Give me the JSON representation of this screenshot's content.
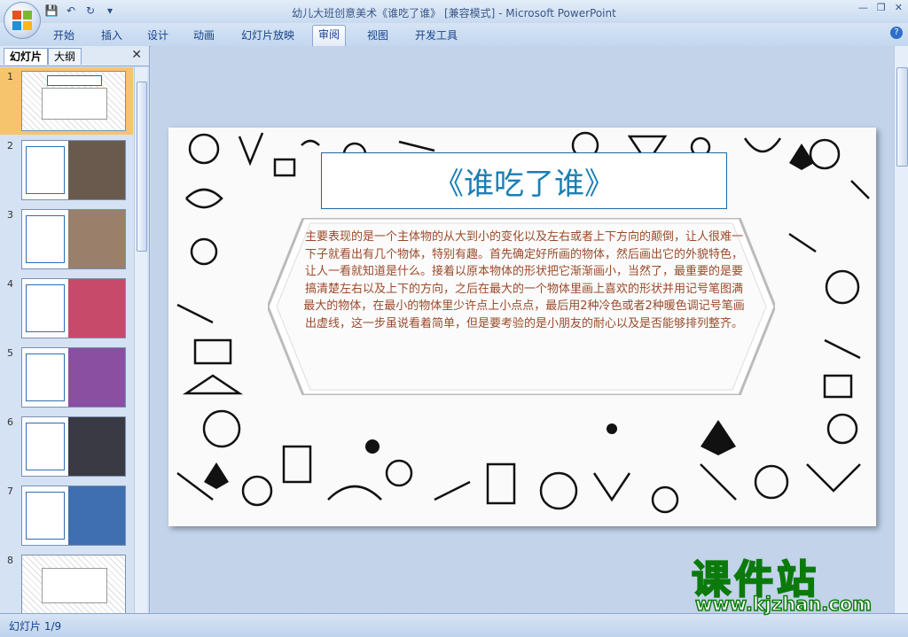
{
  "window": {
    "title": "幼儿大班创意美术《谁吃了谁》 [兼容模式] - Microsoft PowerPoint",
    "controls": [
      "minimize",
      "restore",
      "close"
    ]
  },
  "quick_access": [
    "save-icon",
    "undo-icon",
    "redo-icon",
    "customize-icon"
  ],
  "ribbon": {
    "tabs": [
      {
        "label": "开始"
      },
      {
        "label": "插入"
      },
      {
        "label": "设计"
      },
      {
        "label": "动画"
      },
      {
        "label": "幻灯片放映"
      },
      {
        "label": "审阅",
        "active": true
      },
      {
        "label": "视图"
      },
      {
        "label": "开发工具"
      }
    ]
  },
  "left_pane": {
    "tabs": [
      {
        "label": "幻灯片",
        "active": true
      },
      {
        "label": "大纲"
      }
    ],
    "thumbnails": [
      {
        "num": "1",
        "selected": true
      },
      {
        "num": "2"
      },
      {
        "num": "3"
      },
      {
        "num": "4"
      },
      {
        "num": "5"
      },
      {
        "num": "6"
      },
      {
        "num": "7"
      },
      {
        "num": "8"
      }
    ]
  },
  "slide": {
    "title": "《谁吃了谁》",
    "body": "主要表现的是一个主体物的从大到小的变化以及左右或者上下方向的颠倒，让人很难一下子就看出有几个物体，特别有趣。首先确定好所画的物体，然后画出它的外貌特色，让人一看就知道是什么。接着以原本物体的形状把它渐渐画小，当然了，最重要的是要搞清楚左右以及上下的方向，之后在最大的一个物体里画上喜欢的形状并用记号笔图满最大的物体，在最小的物体里少许点上小点点，最后用2种冷色或者2种暖色调记号笔画出虚线，这一步虽说看着简单，但是要考验的是小朋友的耐心以及是否能够排列整齐。",
    "title_color": "#1a7fb3",
    "body_color": "#9b4a2a"
  },
  "status": {
    "text": "幻灯片 1/9"
  },
  "watermark": {
    "title": "课件站",
    "url": "www.kjzhan.com"
  }
}
